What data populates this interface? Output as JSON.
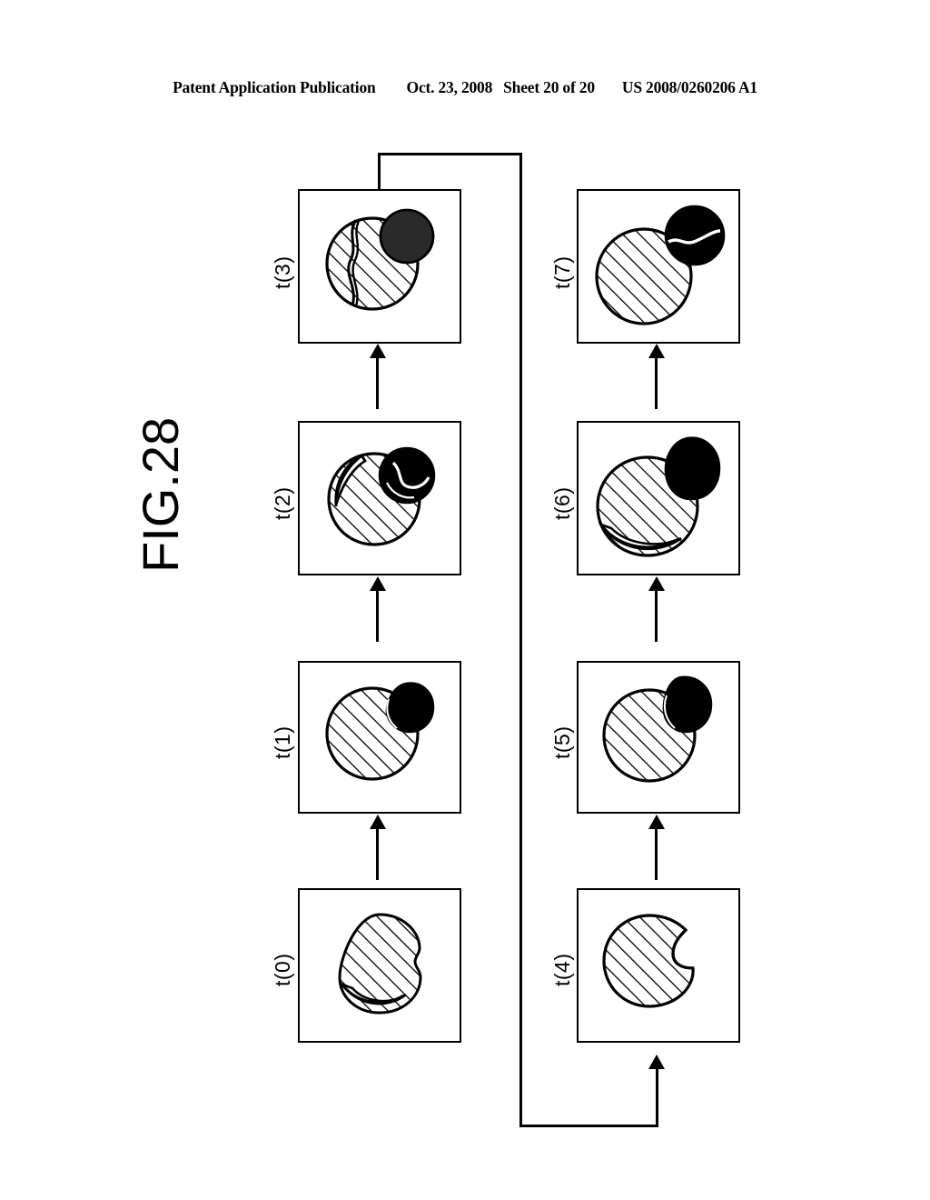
{
  "header": {
    "publication": "Patent Application Publication",
    "date": "Oct. 23, 2008",
    "sheet": "Sheet 20 of 20",
    "patent_number": "US 2008/0260206 A1"
  },
  "figure": {
    "label": "FIG.28"
  },
  "panels": [
    {
      "id": "t0",
      "label": "t(0)",
      "column": "left",
      "description": "hatched irregular blob with crescent at lower edge"
    },
    {
      "id": "t1",
      "label": "t(1)",
      "column": "left",
      "description": "hatched circle with solid black blob at upper right"
    },
    {
      "id": "t2",
      "label": "t(2)",
      "column": "left",
      "description": "hatched circle with left crescent and black blob with white swirl at upper right"
    },
    {
      "id": "t3",
      "label": "t(3)",
      "column": "left",
      "description": "hatched circle split by wavy line with dark stippled ball at upper right"
    },
    {
      "id": "t4",
      "label": "t(4)",
      "column": "right",
      "description": "hatched circle with notch bitten from upper right"
    },
    {
      "id": "t5",
      "label": "t(5)",
      "column": "right",
      "description": "hatched circle with solid black blob at upper right"
    },
    {
      "id": "t6",
      "label": "t(6)",
      "column": "right",
      "description": "hatched circle with lower crescent and detached black blob at upper right"
    },
    {
      "id": "t7",
      "label": "t(7)",
      "column": "right",
      "description": "clean hatched circle with detached black ball bearing white wavy line"
    }
  ],
  "colors": {
    "ink": "#000000",
    "paper": "#ffffff"
  }
}
